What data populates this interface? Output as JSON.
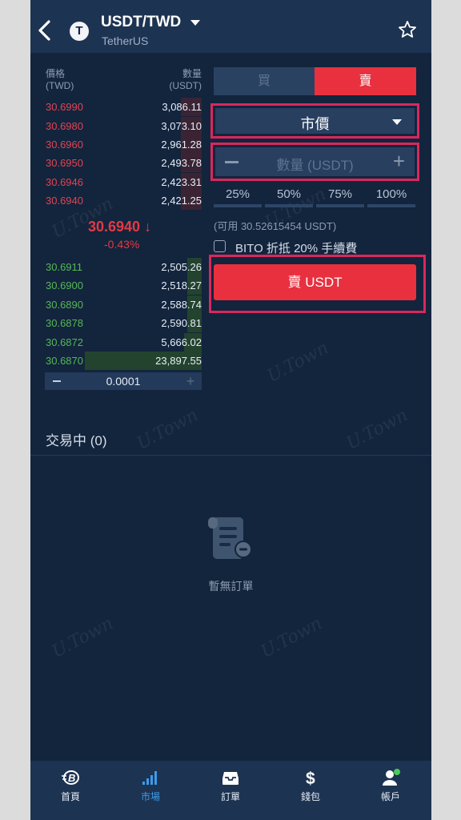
{
  "header": {
    "pair": "USDT/TWD",
    "subtitle": "TetherUS",
    "logo_letter": "T"
  },
  "orderbook": {
    "price_header": "價格",
    "price_unit": "(TWD)",
    "qty_header": "數量",
    "qty_unit": "(USDT)",
    "asks": [
      {
        "price": "30.6990",
        "qty": "3,086.11"
      },
      {
        "price": "30.6980",
        "qty": "3,073.10"
      },
      {
        "price": "30.6960",
        "qty": "2,961.28"
      },
      {
        "price": "30.6950",
        "qty": "2,493.78"
      },
      {
        "price": "30.6946",
        "qty": "2,423.31"
      },
      {
        "price": "30.6940",
        "qty": "2,421.25"
      }
    ],
    "last_price": "30.6940 ↓",
    "last_change": "-0.43%",
    "bids": [
      {
        "price": "30.6911",
        "qty": "2,505.26"
      },
      {
        "price": "30.6900",
        "qty": "2,518.27"
      },
      {
        "price": "30.6890",
        "qty": "2,588.74"
      },
      {
        "price": "30.6878",
        "qty": "2,590.81"
      },
      {
        "price": "30.6872",
        "qty": "5,666.02"
      },
      {
        "price": "30.6870",
        "qty": "23,897.55"
      }
    ],
    "precision_value": "0.0001",
    "precision_plus": "+"
  },
  "order_form": {
    "tab_buy": "買",
    "tab_sell": "賣",
    "order_type": "市價",
    "qty_placeholder": "數量 (USDT)",
    "qty_plus": "+",
    "percents": [
      "25%",
      "50%",
      "75%",
      "100%"
    ],
    "available": "(可用 30.52615454 USDT)",
    "discount_label": "BITO 折抵 20% 手續費",
    "submit_label": "賣 USDT"
  },
  "open_orders": {
    "title": "交易中 (0)",
    "empty_text": "暫無訂單"
  },
  "watermark": "U.Town",
  "nav": [
    {
      "label": "首頁",
      "icon": "home-logo-icon"
    },
    {
      "label": "市場",
      "icon": "market-bars-icon",
      "active": true
    },
    {
      "label": "訂單",
      "icon": "orders-inbox-icon"
    },
    {
      "label": "錢包",
      "icon": "dollar-wallet-icon"
    },
    {
      "label": "帳戶",
      "icon": "account-person-icon"
    }
  ],
  "colors": {
    "bg": "#13243d",
    "header": "#1d3352",
    "sell": "#e8303f",
    "ask": "#e24452",
    "bid": "#55b855",
    "highlight": "#d9285c",
    "active_nav": "#3d9bea"
  }
}
